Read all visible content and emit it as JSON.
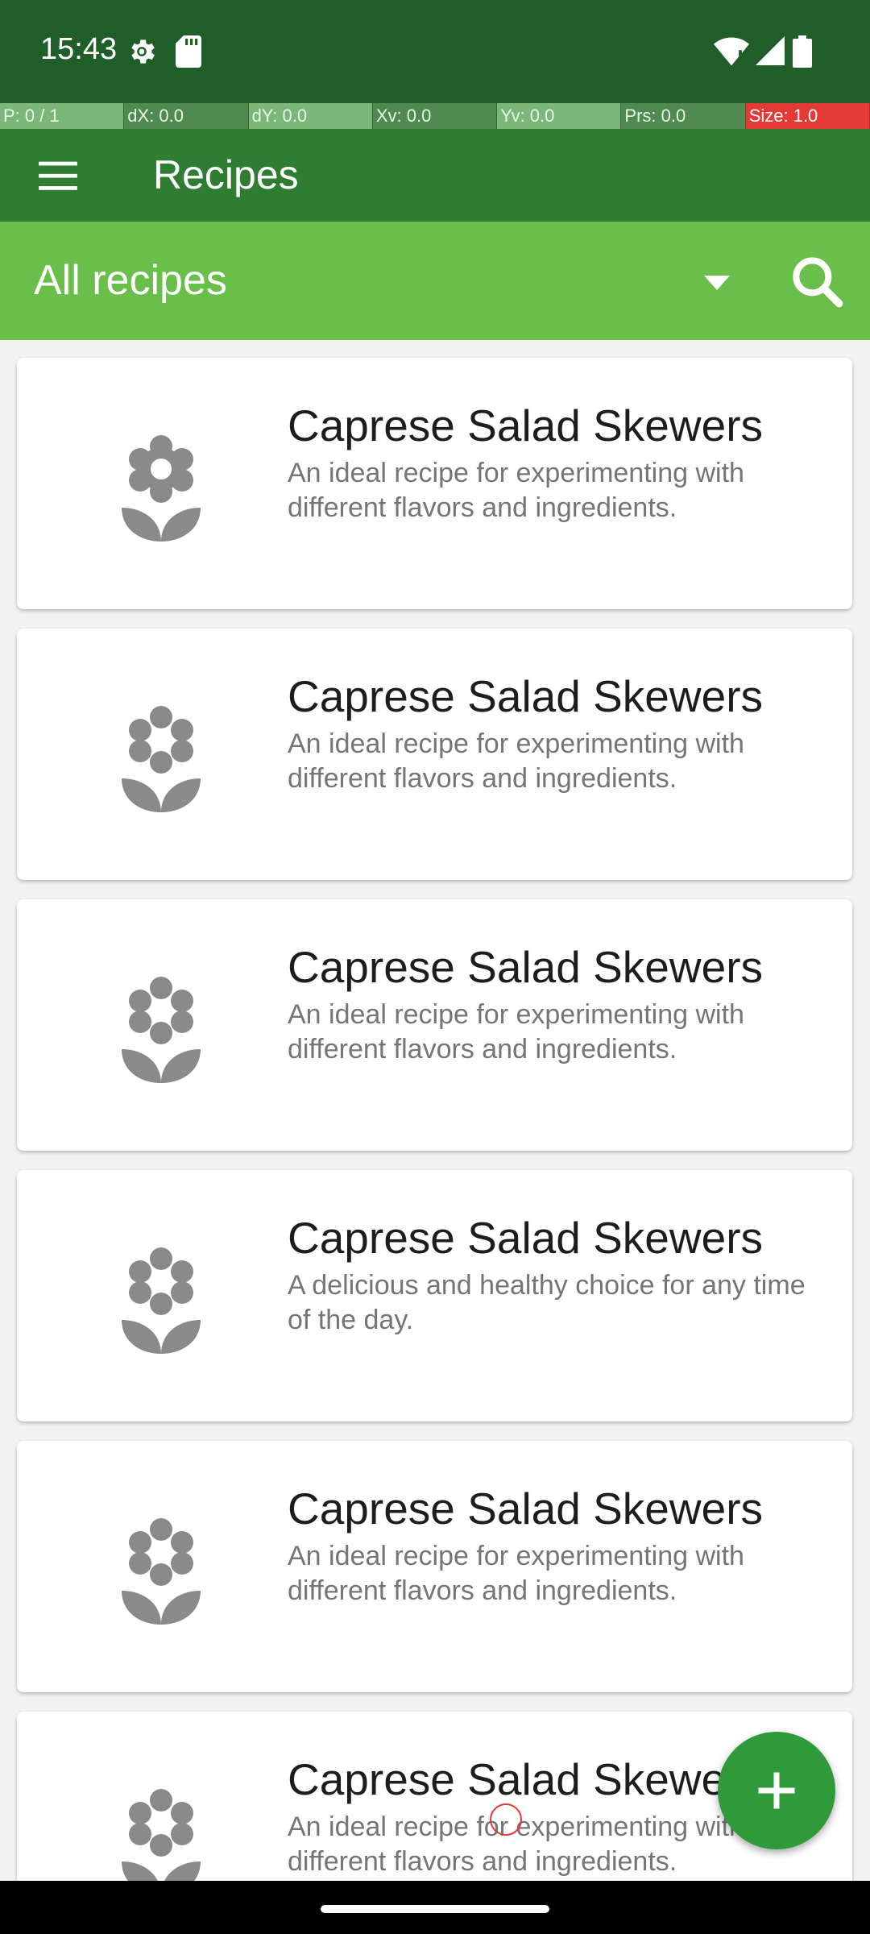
{
  "status_bar": {
    "time": "15:43",
    "icons": [
      "settings-icon",
      "sd-card-icon",
      "wifi-icon",
      "signal-icon",
      "battery-icon"
    ]
  },
  "debug_overlay": [
    "P: 0 / 1",
    "dX: 0.0",
    "dY: 0.0",
    "Xv: 0.0",
    "Yv: 0.0",
    "Prs: 0.0",
    "Size: 1.0"
  ],
  "app_bar": {
    "title": "Recipes",
    "menu_icon": "hamburger-menu-icon"
  },
  "filter": {
    "selected": "All recipes",
    "search_icon": "search-icon"
  },
  "recipes": [
    {
      "name": "Caprese Salad Skewers",
      "description": "An ideal recipe for experimenting with different flavors and ingredients."
    },
    {
      "name": "Caprese Salad Skewers",
      "description": "An ideal recipe for experimenting with different flavors and ingredients."
    },
    {
      "name": "Caprese Salad Skewers",
      "description": "An ideal recipe for experimenting with different flavors and ingredients."
    },
    {
      "name": "Caprese Salad Skewers",
      "description": "A delicious and healthy choice for any time of the day."
    },
    {
      "name": "Caprese Salad Skewers",
      "description": "An ideal recipe for experimenting with different flavors and ingredients."
    },
    {
      "name": "Caprese Salad Skewers",
      "description": "An ideal recipe for experimenting with different flavors and ingredients."
    }
  ],
  "fab": {
    "icon": "add-icon"
  },
  "colors": {
    "status_bar": "#1f5e28",
    "app_bar": "#2e7d32",
    "filter_bar": "#6abf4b",
    "fab": "#2e9a3a"
  }
}
